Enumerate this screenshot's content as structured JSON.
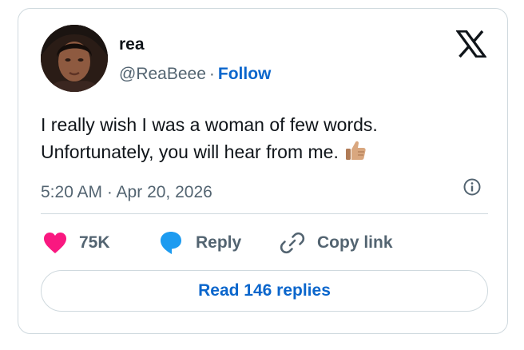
{
  "author": {
    "name": "rea",
    "handle": "@ReaBeee",
    "separator": "·",
    "follow_label": "Follow"
  },
  "tweet": {
    "lines": [
      "I really wish I was a woman of few words.",
      "Unfortunately, you will hear from me."
    ],
    "emoji": "thumbs-up-medium-light-skin-tone",
    "timestamp": "5:20 AM · Apr 20, 2026"
  },
  "actions": {
    "like_count": "75K",
    "reply_label": "Reply",
    "copy_link_label": "Copy link"
  },
  "read_replies_label": "Read 146 replies",
  "colors": {
    "accent": "#0b66cc",
    "heart": "#f91880",
    "reply_bubble": "#1d9bf0",
    "muted": "#536471",
    "border": "#cfd9de"
  },
  "icons": [
    "x-logo",
    "heart-icon",
    "reply-icon",
    "link-icon",
    "info-icon",
    "thumbs-up-emoji"
  ]
}
